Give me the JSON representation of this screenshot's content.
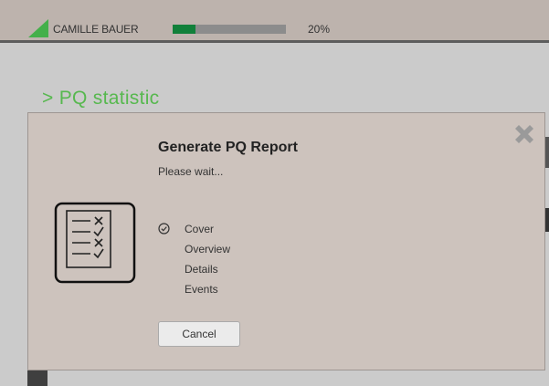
{
  "header": {
    "brand": "CAMILLE BAUER",
    "progress_fraction": 0.2,
    "progress_text": "20%",
    "accent_color": "#44b04a"
  },
  "page": {
    "title": "> PQ statistic"
  },
  "dialog": {
    "title": "Generate PQ Report",
    "status": "Please wait...",
    "close_icon": "close-x-icon",
    "report_icon": "checklist-document-icon",
    "steps": [
      {
        "label": "Cover",
        "done": true
      },
      {
        "label": "Overview",
        "done": false
      },
      {
        "label": "Details",
        "done": false
      },
      {
        "label": "Events",
        "done": false
      }
    ],
    "cancel_label": "Cancel"
  }
}
